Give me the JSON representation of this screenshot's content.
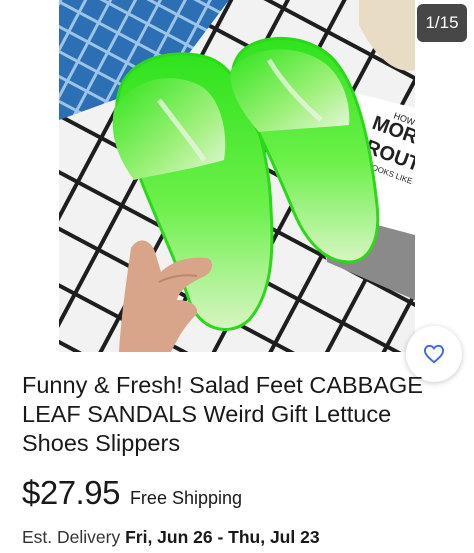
{
  "gallery": {
    "counter": "1/15",
    "book_text": [
      "HOW",
      "MORN",
      "ROUTI",
      "LOOKS LIKE"
    ]
  },
  "listing": {
    "title": "Funny & Fresh! Salad Feet CABBAGE LEAF SANDALS Weird Gift Lettuce Shoes Slippers",
    "price": "$27.95",
    "shipping": "Free Shipping",
    "delivery_label": "Est. Delivery",
    "delivery_range": "Fri, Jun 26 - Thu, Jul 23"
  },
  "icons": {
    "favorite": "heart-outline-icon"
  },
  "colors": {
    "favorite_icon": "#3665f3",
    "sandal_green": "#3ee32a"
  }
}
